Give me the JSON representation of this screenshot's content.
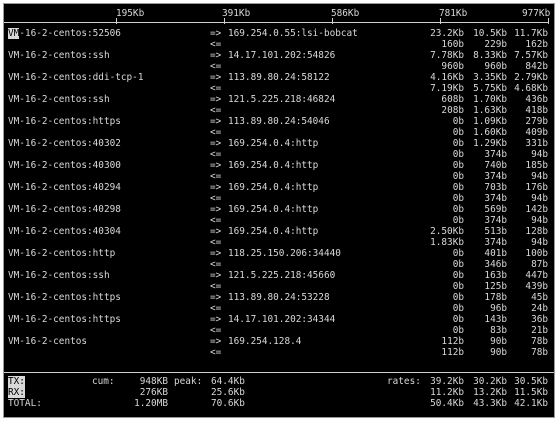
{
  "scale": [
    "195Kb",
    "391Kb",
    "586Kb",
    "781Kb",
    "977Kb"
  ],
  "rows": [
    {
      "src_prefix": "VM",
      "src": "-16-2-centos:52506",
      "dst": "169.254.0.55:lsi-bobcat",
      "out": "=>",
      "in": "<=",
      "tx": [
        "23.2Kb",
        "10.5Kb",
        "11.7Kb"
      ],
      "rx": [
        "160b",
        "229b",
        "162b"
      ]
    },
    {
      "src": "VM-16-2-centos:ssh",
      "dst": "14.17.101.202:54826",
      "out": "=>",
      "in": "<=",
      "tx": [
        "7.78Kb",
        "8.33Kb",
        "7.57Kb"
      ],
      "rx": [
        "960b",
        "960b",
        "842b"
      ]
    },
    {
      "src": "VM-16-2-centos:ddi-tcp-1",
      "dst": "113.89.80.24:58122",
      "out": "=>",
      "in": "<=",
      "tx": [
        "4.16Kb",
        "3.35Kb",
        "2.79Kb"
      ],
      "rx": [
        "7.19Kb",
        "5.75Kb",
        "4.68Kb"
      ]
    },
    {
      "src": "VM-16-2-centos:ssh",
      "dst": "121.5.225.218:46824",
      "out": "=>",
      "in": "<=",
      "tx": [
        "608b",
        "1.70Kb",
        "436b"
      ],
      "rx": [
        "208b",
        "1.63Kb",
        "418b"
      ]
    },
    {
      "src": "VM-16-2-centos:https",
      "dst": "113.89.80.24:54046",
      "out": "=>",
      "in": "<=",
      "tx": [
        "0b",
        "1.09Kb",
        "279b"
      ],
      "rx": [
        "0b",
        "1.60Kb",
        "409b"
      ]
    },
    {
      "src": "VM-16-2-centos:40302",
      "dst": "169.254.0.4:http",
      "out": "=>",
      "in": "<=",
      "tx": [
        "0b",
        "1.29Kb",
        "331b"
      ],
      "rx": [
        "0b",
        "374b",
        "94b"
      ]
    },
    {
      "src": "VM-16-2-centos:40300",
      "dst": "169.254.0.4:http",
      "out": "=>",
      "in": "<=",
      "tx": [
        "0b",
        "740b",
        "185b"
      ],
      "rx": [
        "0b",
        "374b",
        "94b"
      ]
    },
    {
      "src": "VM-16-2-centos:40294",
      "dst": "169.254.0.4:http",
      "out": "=>",
      "in": "<=",
      "tx": [
        "0b",
        "703b",
        "176b"
      ],
      "rx": [
        "0b",
        "374b",
        "94b"
      ]
    },
    {
      "src": "VM-16-2-centos:40298",
      "dst": "169.254.0.4:http",
      "out": "=>",
      "in": "<=",
      "tx": [
        "0b",
        "569b",
        "142b"
      ],
      "rx": [
        "0b",
        "374b",
        "94b"
      ]
    },
    {
      "src": "VM-16-2-centos:40304",
      "dst": "169.254.0.4:http",
      "out": "=>",
      "in": "<=",
      "tx": [
        "2.50Kb",
        "513b",
        "128b"
      ],
      "rx": [
        "1.83Kb",
        "374b",
        "94b"
      ]
    },
    {
      "src": "VM-16-2-centos:http",
      "dst": "118.25.150.206:34440",
      "out": "=>",
      "in": "<=",
      "tx": [
        "0b",
        "401b",
        "100b"
      ],
      "rx": [
        "0b",
        "346b",
        "87b"
      ]
    },
    {
      "src": "VM-16-2-centos:ssh",
      "dst": "121.5.225.218:45660",
      "out": "=>",
      "in": "<=",
      "tx": [
        "0b",
        "163b",
        "447b"
      ],
      "rx": [
        "0b",
        "125b",
        "439b"
      ]
    },
    {
      "src": "VM-16-2-centos:https",
      "dst": "113.89.80.24:53228",
      "out": "=>",
      "in": "<=",
      "tx": [
        "0b",
        "178b",
        "45b"
      ],
      "rx": [
        "0b",
        "96b",
        "24b"
      ]
    },
    {
      "src": "VM-16-2-centos:https",
      "dst": "14.17.101.202:34344",
      "out": "=>",
      "in": "<=",
      "tx": [
        "0b",
        "143b",
        "36b"
      ],
      "rx": [
        "0b",
        "83b",
        "21b"
      ]
    },
    {
      "src": "VM-16-2-centos",
      "dst": "169.254.128.4",
      "out": "=>",
      "in": "<=",
      "tx": [
        "112b",
        "90b",
        "78b"
      ],
      "rx": [
        "112b",
        "90b",
        "78b"
      ]
    }
  ],
  "footer": {
    "tx_label": "TX:",
    "rx_label": "RX:",
    "total_label": "TOTAL:",
    "cum_label": "cum:",
    "peak_label": "peak:",
    "rates_label": "rates:",
    "tx_cum": "948KB",
    "rx_cum": "276KB",
    "total_cum": "1.20MB",
    "tx_peak": "64.4Kb",
    "rx_peak": "25.6Kb",
    "total_peak": "70.6Kb",
    "tx_rates": [
      "39.2Kb",
      "30.2Kb",
      "30.5Kb"
    ],
    "rx_rates": [
      "11.2Kb",
      "13.2Kb",
      "11.5Kb"
    ],
    "total_rates": [
      "50.4Kb",
      "43.3Kb",
      "42.1Kb"
    ]
  }
}
